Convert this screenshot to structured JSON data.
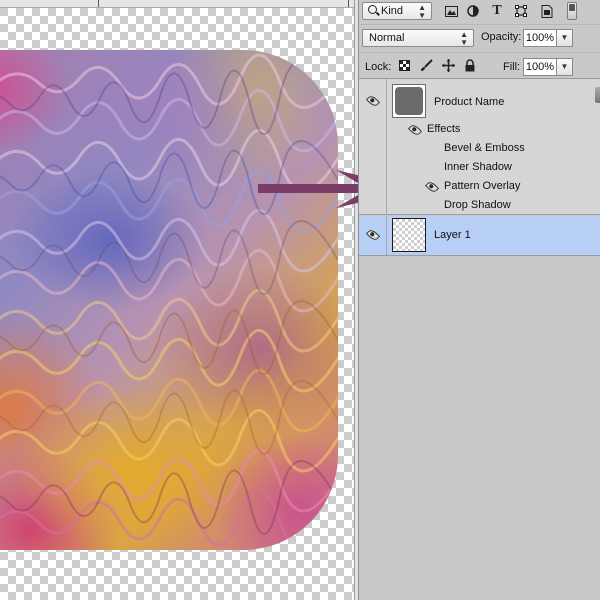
{
  "filter_bar": {
    "kind_label": "Kind",
    "icons": [
      "image-filter-icon",
      "adjustment-filter-icon",
      "type-filter-icon",
      "shape-filter-icon",
      "smart-object-filter-icon",
      "filter-toggle-icon"
    ]
  },
  "blend_bar": {
    "mode_value": "Normal",
    "opacity_label": "Opacity:",
    "opacity_value": "100%"
  },
  "lock_bar": {
    "lock_label": "Lock:",
    "fill_label": "Fill:",
    "fill_value": "100%",
    "icons": [
      "lock-transparent-pixels-icon",
      "lock-image-pixels-icon",
      "lock-position-icon",
      "lock-all-icon"
    ]
  },
  "layers": [
    {
      "name": "Product Name",
      "effects_label": "Effects",
      "effects": [
        "Bevel & Emboss",
        "Inner Shadow",
        "Pattern Overlay",
        "Drop Shadow"
      ],
      "visible_effect": "Pattern Overlay"
    },
    {
      "name": "Layer 1",
      "selected": true
    }
  ],
  "colors": {
    "arrow": "#7a3d68",
    "selected_row": "#b8cff5",
    "panel_bg": "#c9c9c9"
  }
}
